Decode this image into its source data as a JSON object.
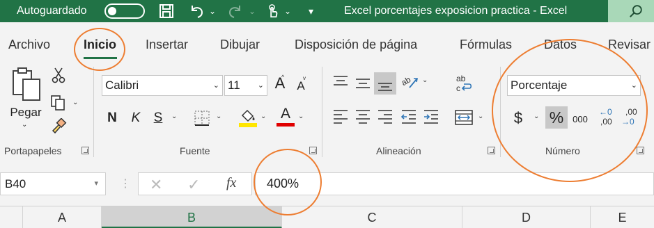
{
  "titlebar": {
    "autosave_label": "Autoguardado",
    "document_title": "Excel porcentajes exposicion practica  -  Excel",
    "icons": [
      "save-icon",
      "undo-icon",
      "redo-icon",
      "touch-mode-icon",
      "customize-qat-icon",
      "search-icon"
    ]
  },
  "tabs": {
    "archivo": "Archivo",
    "inicio": "Inicio",
    "insertar": "Insertar",
    "dibujar": "Dibujar",
    "disposicion": "Disposición de página",
    "formulas": "Fórmulas",
    "datos": "Datos",
    "revisar": "Revisar"
  },
  "ribbon": {
    "clipboard": {
      "paste_label": "Pegar",
      "group_label": "Portapapeles"
    },
    "font": {
      "font_name": "Calibri",
      "font_size": "11",
      "bold": "N",
      "italic": "K",
      "underline": "S",
      "grow": "A",
      "shrink": "A",
      "font_color": "A",
      "group_label": "Fuente"
    },
    "alignment": {
      "group_label": "Alineación",
      "wrap": "ab"
    },
    "number": {
      "format": "Porcentaje",
      "currency": "$",
      "percent": "%",
      "thousands": "000",
      "dec_increase_top": "←0",
      "dec_increase_bottom": ",00",
      "dec_decrease_top": ",00",
      "dec_decrease_bottom": "→0",
      "group_label": "Número"
    }
  },
  "formula_bar": {
    "name_box": "B40",
    "formula": "400%",
    "fx": "fx"
  },
  "columns": [
    "A",
    "B",
    "C",
    "D",
    "E"
  ],
  "colors": {
    "excel_green": "#217346",
    "annotation_orange": "#ed7d31",
    "yellow": "#ffe600",
    "red": "#e00000"
  }
}
